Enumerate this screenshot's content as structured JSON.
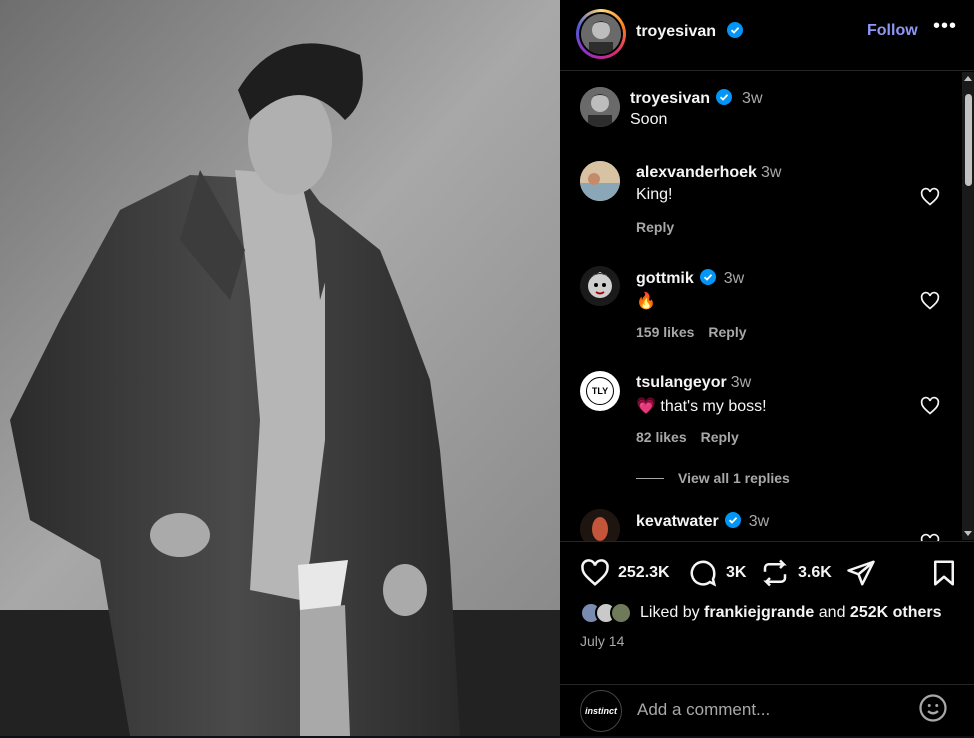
{
  "post_author": {
    "username": "troyesivan",
    "verified": true
  },
  "header": {
    "follow_label": "Follow",
    "more_label": "•••"
  },
  "caption": {
    "username": "troyesivan",
    "time": "3w",
    "text": "Soon"
  },
  "comments": [
    {
      "username": "alexvanderhoek",
      "verified": false,
      "time": "3w",
      "text": "King!",
      "likes": "",
      "reply_label": "Reply"
    },
    {
      "username": "gottmik",
      "verified": true,
      "time": "3w",
      "text": "🔥",
      "likes": "159 likes",
      "reply_label": "Reply"
    },
    {
      "username": "tsulangeyor",
      "verified": false,
      "time": "3w",
      "text": "💗 that's my boss!",
      "likes": "82 likes",
      "reply_label": "Reply",
      "avatar_text": "TLY",
      "view_replies": "View all 1 replies"
    },
    {
      "username": "kevatwater",
      "verified": true,
      "time": "3w",
      "text": "",
      "likes": "",
      "reply_label": ""
    }
  ],
  "stats": {
    "likes": "252.3K",
    "comments": "3K",
    "reposts": "3.6K"
  },
  "liked_by": {
    "prefix": "Liked by",
    "user": "frankiejgrande",
    "conj": "and",
    "others": "252K others"
  },
  "date": "July 14",
  "add_comment": {
    "placeholder": "Add a comment...",
    "avatar_text": "instinct"
  },
  "colors": {
    "accent": "#8d97f5",
    "verified": "#0095f6",
    "muted": "#a8a8a8",
    "background": "#000000"
  }
}
